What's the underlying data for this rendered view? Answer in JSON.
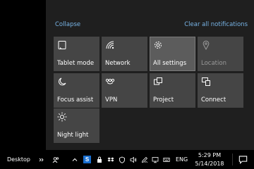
{
  "action_center": {
    "collapse_label": "Collapse",
    "clear_label": "Clear all notifications",
    "tiles": [
      {
        "label": "Tablet mode",
        "icon": "tablet-mode-icon"
      },
      {
        "label": "Network",
        "icon": "network-icon"
      },
      {
        "label": "All settings",
        "icon": "gear-icon",
        "state": "active"
      },
      {
        "label": "Location",
        "icon": "location-icon",
        "state": "disabled"
      },
      {
        "label": "Focus assist",
        "icon": "moon-icon"
      },
      {
        "label": "VPN",
        "icon": "vpn-icon"
      },
      {
        "label": "Project",
        "icon": "project-icon"
      },
      {
        "label": "Connect",
        "icon": "connect-icon"
      },
      {
        "label": "Night light",
        "icon": "sun-icon"
      }
    ]
  },
  "taskbar": {
    "desktop_label": "Desktop",
    "language": "ENG",
    "time": "5:29 PM",
    "date": "5/14/2018",
    "tray_icons": [
      "people-icon",
      "chevron-up-icon",
      "s-app-icon",
      "bag-icon",
      "dropbox-icon",
      "shield-icon",
      "volume-icon",
      "pen-icon",
      "monitor-icon",
      "keyboard-icon"
    ],
    "s_badge": "S"
  },
  "colors": {
    "panel": "#1f1f1f",
    "tile": "#454545",
    "tile_active": "#5c5c5c",
    "link": "#78b4e6",
    "taskbar": "#000000"
  }
}
